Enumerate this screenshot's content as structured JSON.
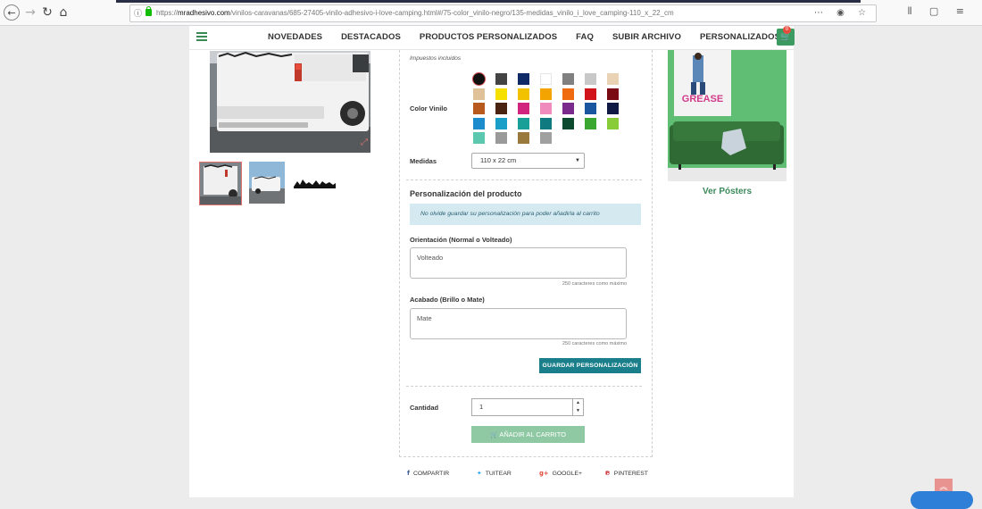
{
  "browser": {
    "url_prefix": "https://",
    "url_domain": "mradhesivo.com",
    "url_path": "/vinilos-caravanas/685-27405-vinilo-adhesivo-i-love-camping.html#/75-color_vinilo-negro/135-medidas_vinilo_i_love_camping-110_x_22_cm",
    "toolbar_icons": "⋯ ◉ ☆",
    "right_icons": "⫴ ▢ ≡"
  },
  "nav": {
    "items": [
      "NOVEDADES",
      "DESTACADOS",
      "PRODUCTOS PERSONALIZADOS",
      "FAQ",
      "SUBIR ARCHIVO",
      "PERSONALIZADOS"
    ],
    "cart_count": "0"
  },
  "product": {
    "tax_note": "Impuestos incluidos",
    "color_label": "Color Vinilo",
    "colors": [
      "#111111",
      "#444444",
      "#0f2a66",
      "#ffffff",
      "#808080",
      "#c8c8c8",
      "#ead3b5",
      "#dfc29a",
      "#f5e000",
      "#f2c200",
      "#f4a400",
      "#f06a10",
      "#d0141a",
      "#7a0b14",
      "#b85a1e",
      "#4a2410",
      "#d1247e",
      "#f08cbd",
      "#7a2a8c",
      "#1a56a0",
      "#101a44",
      "#1c8ccc",
      "#1aa0c8",
      "#18a098",
      "#0f7a80",
      "#0b4a2e",
      "#3aa830",
      "#88cc3a",
      "#5cc8b0",
      "#9a9a9a",
      "#9a7a3c",
      "#a0a0a0"
    ],
    "size_label": "Medidas",
    "size_value": "110 x 22 cm",
    "custom_title": "Personalización del producto",
    "custom_info": "No olvide guardar su personalización para poder añadirla al carrito",
    "orientation_label": "Orientación (Normal o Volteado)",
    "orientation_value": "Volteado",
    "finish_label": "Acabado (Brillo o Mate)",
    "finish_value": "Mate",
    "char_limit": "250 caracteres como máximo",
    "save_button": "GUARDAR PERSONALIZACIÓN",
    "qty_label": "Cantidad",
    "qty_value": "1",
    "add_to_cart": "AÑADIR AL CARRITO"
  },
  "social": {
    "share": "COMPARTIR",
    "tweet": "TUITEAR",
    "google": "GOOGLE+",
    "pinterest": "PINTEREST"
  },
  "poster": {
    "title_art": "GREASE",
    "link": "Ver Pósters"
  }
}
